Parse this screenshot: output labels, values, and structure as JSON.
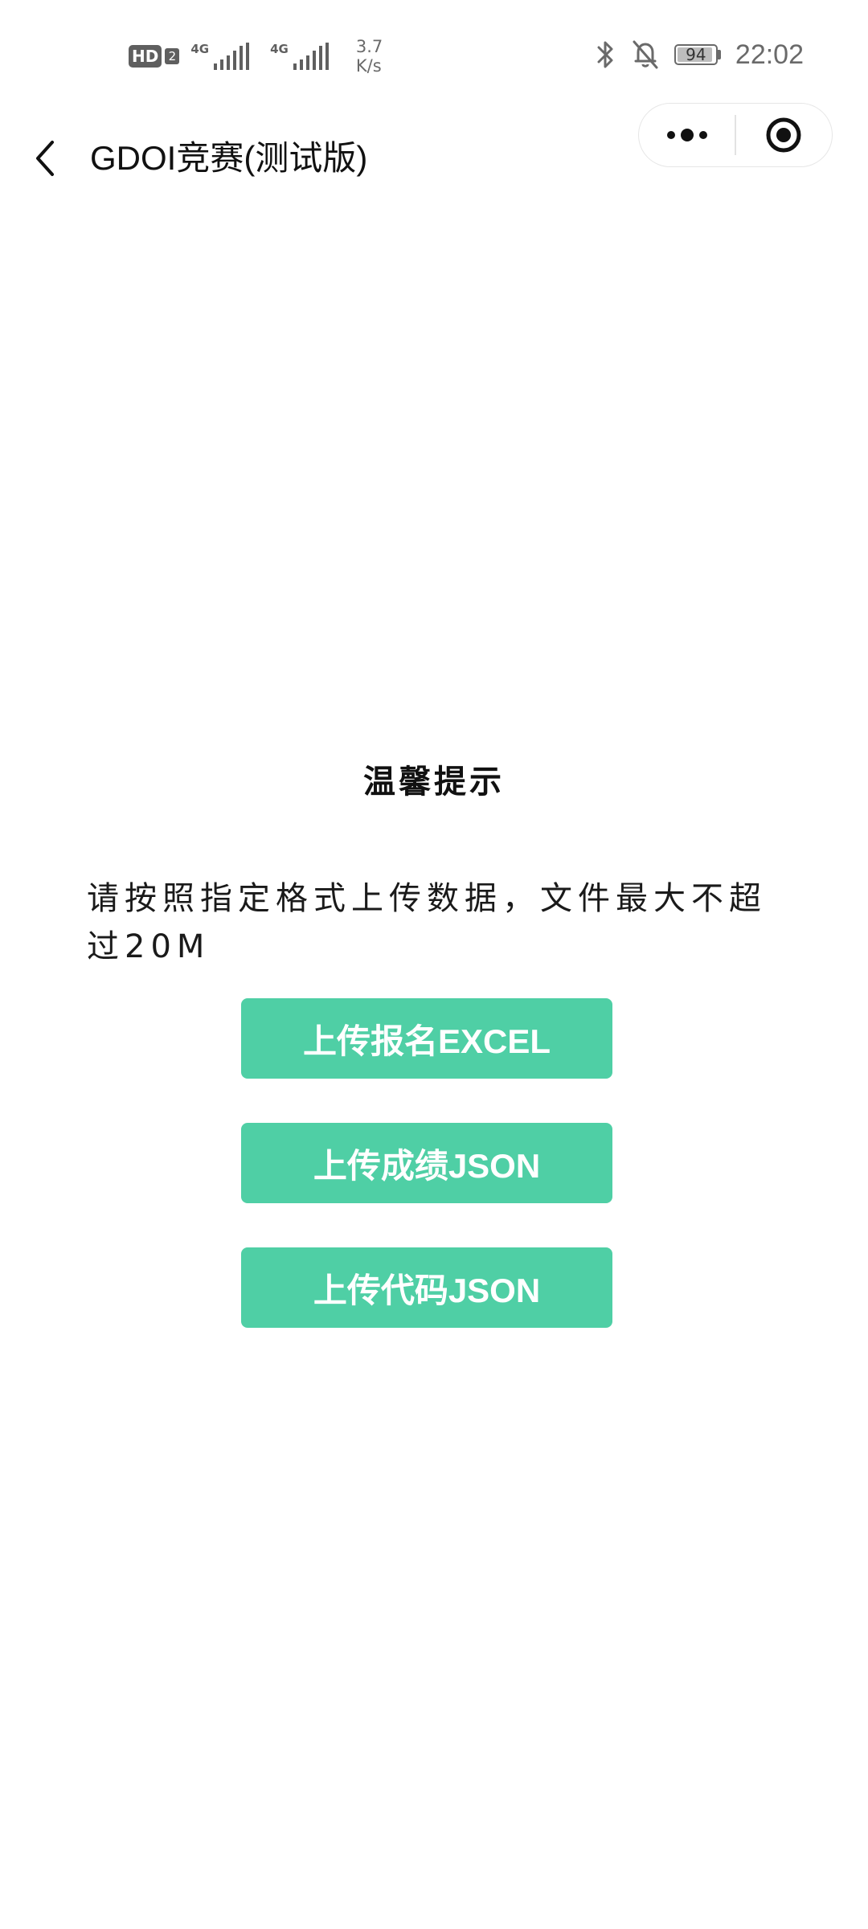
{
  "status_bar": {
    "hd_label": "HD",
    "hd_sim": "2",
    "signal_1_label": "4G",
    "signal_2_label": "4G",
    "speed_value": "3.7",
    "speed_unit": "K/s",
    "battery_level": "94",
    "time": "22:02",
    "icons": [
      "bluetooth-icon",
      "bell-off-icon",
      "battery-icon"
    ]
  },
  "navbar": {
    "title": "GDOI竞赛(测试版)",
    "back_icon": "chevron-left-icon",
    "capsule": {
      "more_icon": "more-dots-icon",
      "close_icon": "target-circle-icon"
    }
  },
  "content": {
    "tip_title": "温馨提示",
    "tip_body": "请按照指定格式上传数据，文件最大不超过20M",
    "buttons": [
      {
        "label": "上传报名EXCEL"
      },
      {
        "label": "上传成绩JSON"
      },
      {
        "label": "上传代码JSON"
      }
    ]
  },
  "colors": {
    "accent": "#4fcfa5",
    "text_primary": "#111111",
    "status_gray": "#6a6a6a",
    "background": "#ffffff"
  }
}
